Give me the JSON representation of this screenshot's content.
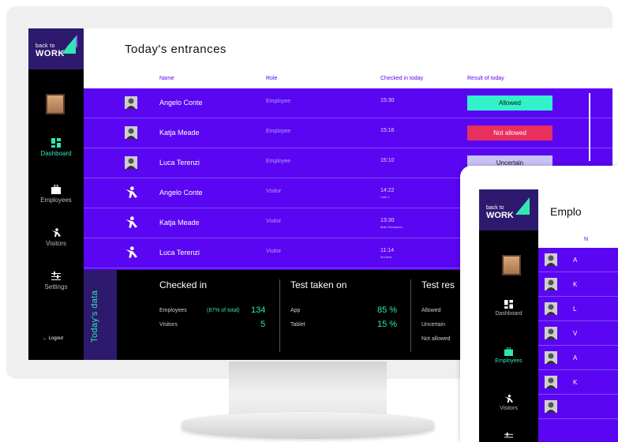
{
  "desktop": {
    "logo": {
      "line1": "back to",
      "line2": "WORK"
    },
    "sidebar": {
      "items": [
        {
          "label": "Dashboard",
          "icon": "dashboard-icon",
          "active": true
        },
        {
          "label": "Employees",
          "icon": "briefcase-icon",
          "active": false
        },
        {
          "label": "Visitors",
          "icon": "visitor-icon",
          "active": false
        },
        {
          "label": "Settings",
          "icon": "sliders-icon",
          "active": false
        }
      ],
      "logout": "Logout"
    },
    "header": {
      "title": "Today's entrances"
    },
    "table": {
      "columns": [
        "Name",
        "Role",
        "Checked in today",
        "Result of today"
      ],
      "rows": [
        {
          "name": "Angelo Conte",
          "role": "Employee",
          "time": "15:30",
          "sub": "",
          "result": "Allowed",
          "type": "employee"
        },
        {
          "name": "Katja Meade",
          "role": "Employee",
          "time": "15:16",
          "sub": "",
          "result": "Not allowed",
          "type": "employee"
        },
        {
          "name": "Luca Terenzi",
          "role": "Employee",
          "time": "15:10",
          "sub": "",
          "result": "Uncertain",
          "type": "employee"
        },
        {
          "name": "Angelo Conte",
          "role": "Visitor",
          "time": "14:22",
          "sub": "Cafe 1",
          "result": "",
          "type": "visitor"
        },
        {
          "name": "Katja Meade",
          "role": "Visitor",
          "time": "13:30",
          "sub": "Main Reception",
          "result": "",
          "type": "visitor"
        },
        {
          "name": "Luca Terenzi",
          "role": "Visitor",
          "time": "11:14",
          "sub": "3rd floor",
          "result": "",
          "type": "visitor"
        }
      ]
    },
    "stats": {
      "label": "Today's data",
      "checked_in": {
        "title": "Checked in",
        "employees_label": "Employees",
        "employees_pct": "(87% of total)",
        "employees_value": "134",
        "visitors_label": "Visitors",
        "visitors_value": "5"
      },
      "test_taken": {
        "title": "Test taken on",
        "app_label": "App",
        "app_value": "85 %",
        "tablet_label": "Tablet",
        "tablet_value": "15 %"
      },
      "test_results": {
        "title": "Test res",
        "allowed_label": "Allowed",
        "uncertain_label": "Uncertain",
        "notallowed_label": "Not allowed"
      }
    }
  },
  "tablet": {
    "logo": {
      "line1": "back to",
      "line2": "WORK"
    },
    "sidebar": {
      "items": [
        {
          "label": "Dashboard",
          "active": false
        },
        {
          "label": "Employees",
          "active": true
        },
        {
          "label": "Visitors",
          "active": false
        }
      ]
    },
    "header": {
      "title": "Emplo"
    },
    "column_label": "N",
    "rows": [
      "A",
      "K",
      "L",
      "V",
      "A",
      "K",
      ""
    ]
  },
  "colors": {
    "accent": "#5a06f2",
    "sidebar_logo_bg": "#2d1a6e",
    "mint": "#31e6b3",
    "allowed": "#31f2c8",
    "not_allowed": "#e92f5c",
    "uncertain": "#c7c2f7"
  }
}
